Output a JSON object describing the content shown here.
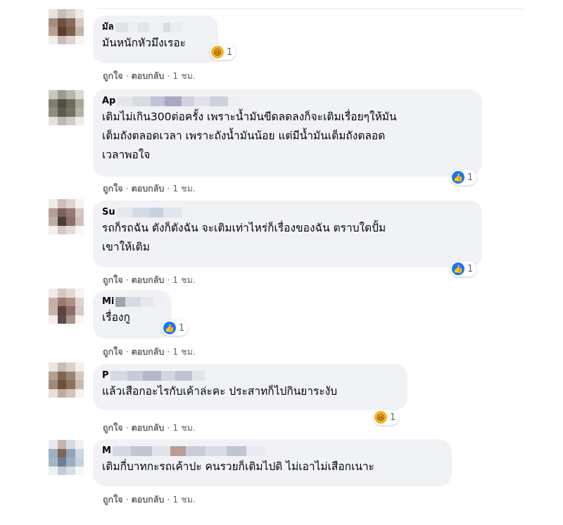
{
  "comments": [
    {
      "name": "มัล",
      "text": "มันหนักหัวมึงเรอะ",
      "reaction": {
        "type": "haha",
        "count": "1"
      },
      "actions": {
        "like": "ถูกใจ",
        "reply": "ตอบกลับ",
        "time": "1 ชม."
      }
    },
    {
      "name": "Ap",
      "text": "เติมไม่เกิน300ต่อครั้ง เพราะน้ำมันขีดลดลงก็จะเติมเรื่อยๆให้มัน\nเต็มถังตลอดเวลา เพราะถังน้ำมันน้อย แต่มีน้ำมันเต็มถังตลอด\nเวลาพอใจ",
      "reaction": {
        "type": "like",
        "count": "1"
      },
      "actions": {
        "like": "ถูกใจ",
        "reply": "ตอบกลับ",
        "time": "1 ชม."
      }
    },
    {
      "name": "Su",
      "text": "รถก็รถฉัน ตังก็ตังฉัน จะเติมเท่าไหร่ก็เรื่องของฉัน ตราบใดปั้ม\nเขาให้เติม",
      "reaction": {
        "type": "like",
        "count": "1"
      },
      "actions": {
        "like": "ถูกใจ",
        "reply": "ตอบกลับ",
        "time": "1 ชม."
      }
    },
    {
      "name": "Mi",
      "text": "เรื่องกู",
      "reaction": {
        "type": "like",
        "count": "1"
      },
      "actions": {
        "like": "ถูกใจ",
        "reply": "ตอบกลับ",
        "time": "1 ชม."
      }
    },
    {
      "name": "P",
      "text": "แล้วเสือกอะไรกับเค้าล่ะคะ ประสาทก็ไปกินยาระงับ",
      "reaction": {
        "type": "haha",
        "count": "1"
      },
      "actions": {
        "like": "ถูกใจ",
        "reply": "ตอบกลับ",
        "time": "1 ชม."
      }
    },
    {
      "name": "M",
      "text": "เติมกี่บาทกะรถเค้าปะ คนรวยก็เติมไปดิ ไม่เอาไม่เสือกเนาะ",
      "reaction": null,
      "actions": {
        "like": "ถูกใจ",
        "reply": "ตอบกลับ",
        "time": "1 ชม."
      }
    }
  ],
  "icons": {
    "like": "thumbs-up-icon",
    "haha": "laughing-face-icon"
  },
  "colors": {
    "bubble": "#f0f2f5",
    "meta": "#65676b",
    "like": "#1877f2",
    "haha": "#f7b125"
  }
}
